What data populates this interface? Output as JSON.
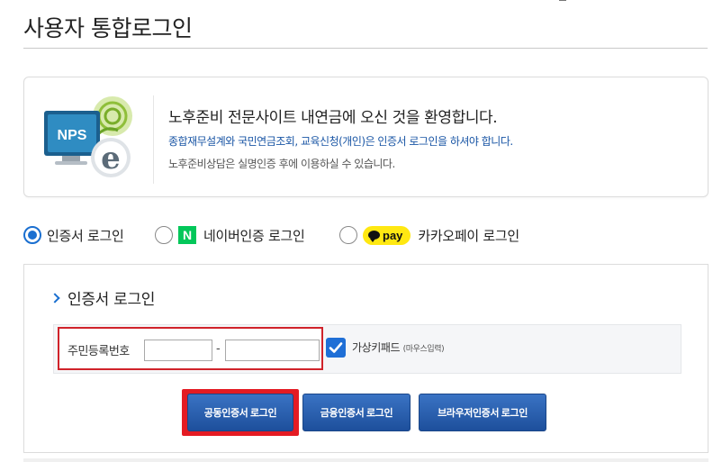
{
  "page": {
    "title": "사용자 통합로그인"
  },
  "welcome": {
    "logo_icon": "nps-logo-icon",
    "logo_text": "NPS",
    "heading": "노후준비 전문사이트 내연금에 오신 것을 환영합니다.",
    "line1": "종합재무설계와 국민연금조회, 교육신청(개인)은 인증서 로그인을 하셔야 합니다.",
    "line2": "노후준비상담은 실명인증 후에 이용하실 수 있습니다."
  },
  "login_methods": [
    {
      "label": "인증서 로그인",
      "selected": true
    },
    {
      "label": "네이버인증 로그인",
      "selected": false,
      "badge": "N"
    },
    {
      "label": "카카오페이 로그인",
      "selected": false,
      "badge": "pay"
    }
  ],
  "panel": {
    "title": "인증서 로그인",
    "id_label": "주민등록번호",
    "id_front_value": "",
    "id_back_value": "",
    "dash": "-",
    "virtual_keypad_checked": true,
    "virtual_keypad_label": "가상키패드",
    "virtual_keypad_note": "(마우스입력)"
  },
  "buttons": {
    "public_cert": "공동인증서 로그인",
    "finance_cert": "금융인증서 로그인",
    "browser_cert": "브라우저인증서 로그인"
  },
  "colors": {
    "accent_blue": "#1a6fd0",
    "button_blue": "#1d4f9c",
    "highlight_red": "#e41b23",
    "naver_green": "#03c75a",
    "kakao_yellow": "#ffe812",
    "info_blue": "#1a56a5"
  }
}
